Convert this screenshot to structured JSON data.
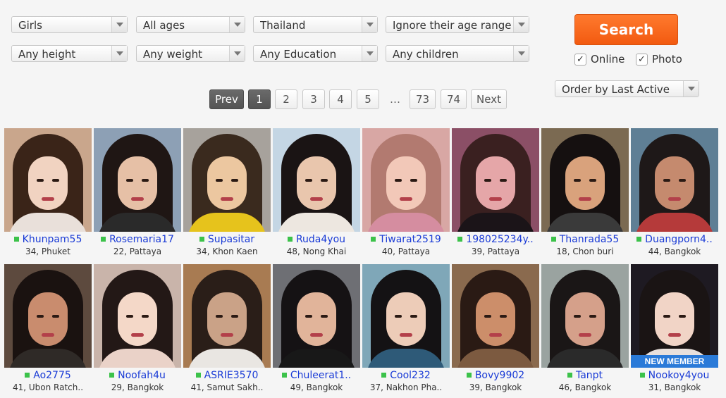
{
  "filters": {
    "gender": "Girls",
    "ages": "All ages",
    "country": "Thailand",
    "age_range": "Ignore their age range",
    "height": "Any height",
    "weight": "Any weight",
    "education": "Any Education",
    "children": "Any children"
  },
  "search": {
    "label": "Search"
  },
  "options": {
    "online_label": "Online",
    "online_checked": "✓",
    "photo_label": "Photo",
    "photo_checked": "✓"
  },
  "order": {
    "label": "Order by Last Active"
  },
  "pagination": {
    "prev": "Prev",
    "current": "1",
    "p2": "2",
    "p3": "3",
    "p4": "4",
    "p5": "5",
    "ellipsis": "…",
    "p73": "73",
    "p74": "74",
    "next": "Next"
  },
  "members": [
    {
      "name": "Khunpam55",
      "info": "34, Phuket",
      "bg": "#c9a68c",
      "hair": "#3a2418",
      "skin": "#f1d3c1",
      "shirt": "#e9e0da"
    },
    {
      "name": "Rosemaria17",
      "info": "22, Pattaya",
      "bg": "#8da0b5",
      "hair": "#1f1614",
      "skin": "#e6c0a6",
      "shirt": "#2a2a2a"
    },
    {
      "name": "Supasitar",
      "info": "34, Khon Kaen",
      "bg": "#a7a29c",
      "hair": "#3a2a1e",
      "skin": "#ecc7a0",
      "shirt": "#e6c31c"
    },
    {
      "name": "Ruda4you",
      "info": "48, Nong Khai",
      "bg": "#c4d6e4",
      "hair": "#1a1414",
      "skin": "#e9c6ad",
      "shirt": "#ede7e0"
    },
    {
      "name": "Tiwarat2519",
      "info": "40, Pattaya",
      "bg": "#d8a7a4",
      "hair": "#b27a70",
      "skin": "#f2c8b8",
      "shirt": "#d58da0"
    },
    {
      "name": "198025234y..",
      "info": "39, Pattaya",
      "bg": "#8b4f66",
      "hair": "#3a2020",
      "skin": "#e5a6a8",
      "shirt": "#1b1418"
    },
    {
      "name": "Thanrada55",
      "info": "18, Chon buri",
      "bg": "#7b6a52",
      "hair": "#151010",
      "skin": "#d9a27c",
      "shirt": "#3a3a3a"
    },
    {
      "name": "Duangporn4..",
      "info": "44, Bangkok",
      "bg": "#5f7f95",
      "hair": "#1e1818",
      "skin": "#c58a6e",
      "shirt": "#b53a3a"
    },
    {
      "name": "Ao2775",
      "info": "41, Ubon Ratch..",
      "bg": "#5d4a3e",
      "hair": "#1a1210",
      "skin": "#c98c6e",
      "shirt": "#2f2a27"
    },
    {
      "name": "Noofah4u",
      "info": "29, Bangkok",
      "bg": "#c9b4aa",
      "hair": "#231816",
      "skin": "#f4d8c8",
      "shirt": "#ead2c8"
    },
    {
      "name": "ASRIE3570",
      "info": "41, Samut Sakh..",
      "bg": "#a87b52",
      "hair": "#2a1e18",
      "skin": "#caa287",
      "shirt": "#e9e6e2"
    },
    {
      "name": "Chuleerat1..",
      "info": "49, Bangkok",
      "bg": "#6e6f74",
      "hair": "#151214",
      "skin": "#e1b49a",
      "shirt": "#181818"
    },
    {
      "name": "Cool232",
      "info": "37, Nakhon Pha..",
      "bg": "#7fa7b8",
      "hair": "#141214",
      "skin": "#edccb8",
      "shirt": "#2e5a78"
    },
    {
      "name": "Bovy9902",
      "info": "39, Bangkok",
      "bg": "#8a6a4e",
      "hair": "#2a1a14",
      "skin": "#cc8e6a",
      "shirt": "#7c5a40"
    },
    {
      "name": "Tanpt",
      "info": "46, Bangkok",
      "bg": "#9aa3a0",
      "hair": "#1a1616",
      "skin": "#d5a08a",
      "shirt": "#2a2a2a"
    },
    {
      "name": "Nookoy4you",
      "info": "31, Bangkok",
      "bg": "#1e1a22",
      "hair": "#1a1414",
      "skin": "#f1d4c6",
      "shirt": "#e8e0dc",
      "badge": "NEW MEMBER"
    }
  ]
}
